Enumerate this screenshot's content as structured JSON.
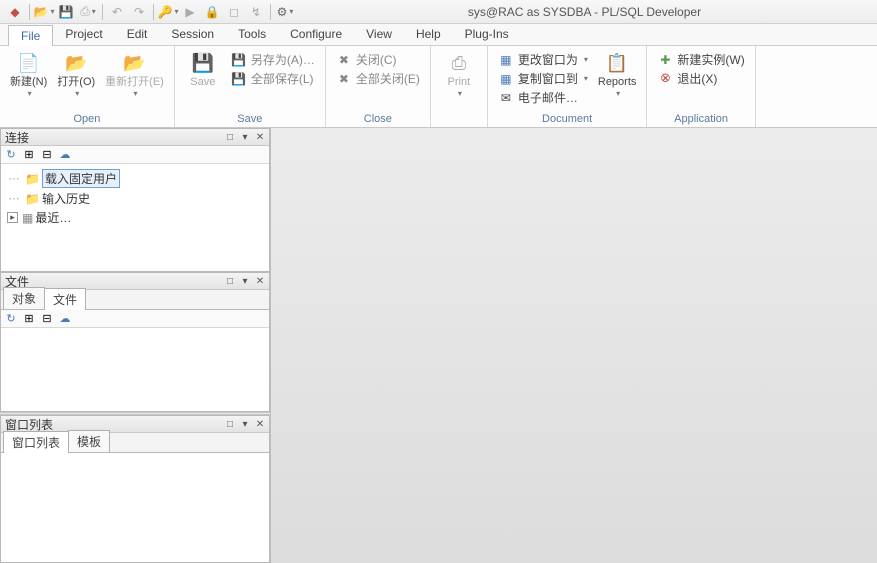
{
  "title": "sys@RAC as SYSDBA - PL/SQL Developer",
  "menus": {
    "file": "File",
    "project": "Project",
    "edit": "Edit",
    "session": "Session",
    "tools": "Tools",
    "configure": "Configure",
    "view": "View",
    "help": "Help",
    "plugins": "Plug-Ins"
  },
  "ribbon": {
    "open": {
      "new": "新建(N)",
      "open": "打开(O)",
      "reopen": "重新打开(E)",
      "label": "Open"
    },
    "save": {
      "save": "Save",
      "saveas": "另存为(A)…",
      "saveall": "全部保存(L)",
      "label": "Save"
    },
    "close": {
      "close": "关闭(C)",
      "closeall": "全部关闭(E)",
      "label": "Close"
    },
    "print": {
      "print": "Print",
      "label": ""
    },
    "document": {
      "changeto": "更改窗口为",
      "copyto": "复制窗口到",
      "email": "电子邮件…",
      "reports": "Reports",
      "label": "Document"
    },
    "application": {
      "newinst": "新建实例(W)",
      "exit": "退出(X)",
      "label": "Application"
    }
  },
  "panels": {
    "connections": {
      "title": "连接",
      "tree": {
        "n1": "载入固定用户",
        "n2": "输入历史",
        "n3": "最近…"
      }
    },
    "files": {
      "title": "文件",
      "tabs": {
        "objects": "对象",
        "files": "文件"
      }
    },
    "windows": {
      "title": "窗口列表",
      "tabs": {
        "list": "窗口列表",
        "template": "模板"
      }
    }
  },
  "hdbtn": {
    "pin": "□",
    "down": "▾",
    "close": "✕"
  }
}
